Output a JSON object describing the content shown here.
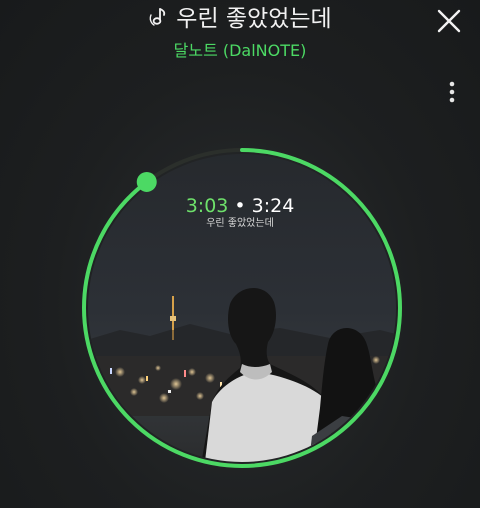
{
  "header": {
    "title": "우린 좋았었는데",
    "artist": "달노트 (DalNOTE)"
  },
  "player": {
    "current_time": "3:03",
    "separator": "•",
    "total_time": "3:24",
    "lyric": "우린 좋았었는데",
    "progress": 0.897
  },
  "colors": {
    "accent": "#4cd964",
    "background": "#1d1f20",
    "text": "#f2f2f2"
  },
  "icons": {
    "title_icon": "music-note-icon",
    "close": "close-icon",
    "more": "more-vertical-icon"
  }
}
